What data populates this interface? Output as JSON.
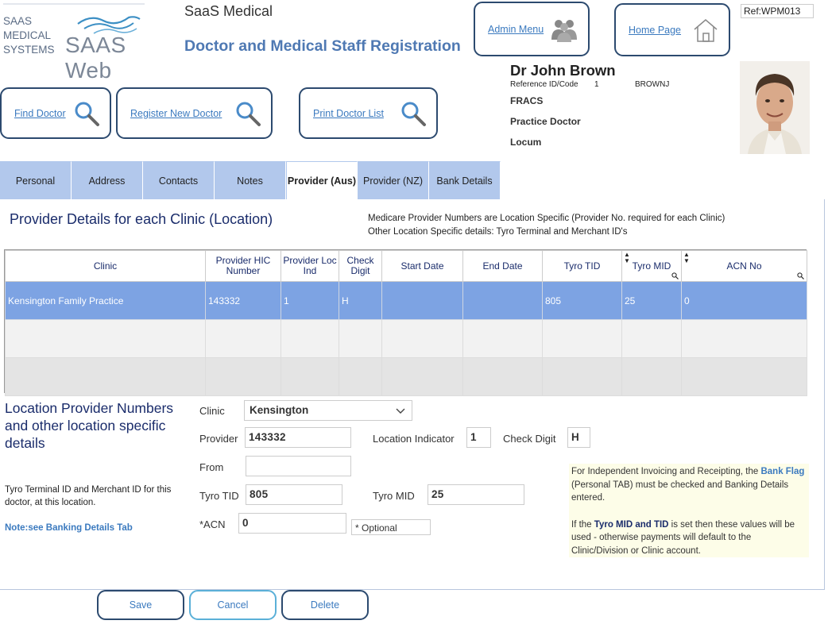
{
  "app": {
    "logo_text": "SAAS\nMEDICAL\nSYSTEMS",
    "logo_web": "SAAS Web",
    "title": "SaaS Medical",
    "page_title": "Doctor and Medical Staff Registration",
    "ref": "Ref:WPM013"
  },
  "nav": {
    "admin_menu": "Admin Menu",
    "home_page": "Home Page",
    "find_doctor": "Find Doctor",
    "register_new_doctor": "Register New Doctor",
    "print_doctor_list": "Print Doctor List"
  },
  "doctor": {
    "name": "Dr John Brown",
    "ref_label": "Reference ID/Code",
    "ref_id": "1",
    "ref_code": "BROWNJ",
    "qualification": "FRACS",
    "role": "Practice Doctor",
    "type": "Locum"
  },
  "tabs": [
    {
      "label": "Personal"
    },
    {
      "label": "Address"
    },
    {
      "label": "Contacts"
    },
    {
      "label": "Notes"
    },
    {
      "label": "Provider (Aus)"
    },
    {
      "label": "Provider (NZ)"
    },
    {
      "label": "Bank Details"
    }
  ],
  "section": {
    "title": "Provider Details for each Clinic (Location)",
    "note_line1": "Medicare Provider Numbers are Location Specific (Provider No. required for each Clinic)",
    "note_line2": "Other Location Specific details: Tyro Terminal and Merchant ID's"
  },
  "grid": {
    "headers": [
      "Clinic",
      "Provider HIC Number",
      "Provider Loc Ind",
      "Check Digit",
      "Start Date",
      "End Date",
      "Tyro TID",
      "Tyro MID",
      "ACN No"
    ],
    "rows": [
      [
        "Kensington Family Practice",
        "143332",
        "1",
        "H",
        "",
        "",
        "805",
        "25",
        "0"
      ]
    ]
  },
  "form": {
    "title": "Location Provider Numbers and other location specific details",
    "clinic_label": "Clinic",
    "clinic_value": "Kensington",
    "provider_label": "Provider",
    "provider_value": "143332",
    "loc_ind_label": "Location Indicator",
    "loc_ind_value": "1",
    "check_digit_label": "Check Digit",
    "check_digit_value": "H",
    "from_label": "From",
    "from_value": "",
    "tyro_tid_label": "Tyro TID",
    "tyro_tid_value": "805",
    "tyro_mid_label": "Tyro MID",
    "tyro_mid_value": "25",
    "acn_label": "*ACN",
    "acn_value": "0",
    "optional_note": "* Optional",
    "side_note": "Tyro Terminal ID and Merchant ID for this doctor, at this location.",
    "note_link": "Note:see Banking Details Tab"
  },
  "info": {
    "p1_a": "For Independent Invoicing and Receipting, the ",
    "p1_hl": "Bank Flag",
    "p1_b": " (Personal TAB) must be checked and Banking Details entered.",
    "p2_a": "If the ",
    "p2_hl": "Tyro MID and TID",
    "p2_b": " is set then these values will be used - otherwise payments will default to the Clinic/Division or Clinic account."
  },
  "actions": {
    "save": "Save",
    "cancel": "Cancel",
    "delete": "Delete"
  },
  "colors": {
    "accent": "#3b7abf",
    "tab_bg": "#b2c8ec",
    "selected_row": "#7da3e3",
    "button_border": "#2c4a6f",
    "title_blue": "#4f79b3"
  }
}
